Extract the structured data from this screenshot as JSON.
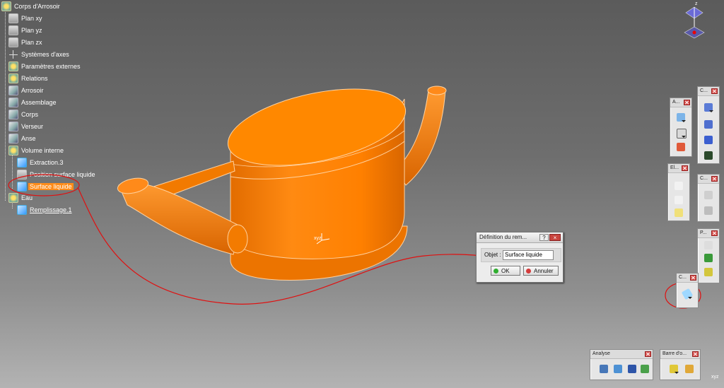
{
  "tree": {
    "root": "Corps d'Arrosoir",
    "items": [
      {
        "label": "Plan xy",
        "icon": "plane-icon"
      },
      {
        "label": "Plan yz",
        "icon": "plane-icon"
      },
      {
        "label": "Plan zx",
        "icon": "plane-icon"
      },
      {
        "label": "Systèmes d'axes",
        "icon": "axis-system-icon"
      },
      {
        "label": "Paramètres externes",
        "icon": "parameters-icon"
      },
      {
        "label": "Relations",
        "icon": "relations-icon"
      },
      {
        "label": "Arrosoir",
        "icon": "body-icon"
      },
      {
        "label": "Assemblage",
        "icon": "body-icon"
      },
      {
        "label": "Corps",
        "icon": "body-icon"
      },
      {
        "label": "Verseur",
        "icon": "body-icon"
      },
      {
        "label": "Anse",
        "icon": "body-icon"
      },
      {
        "label": "Volume interne",
        "icon": "geometrical-set-icon"
      },
      {
        "label": "Extraction.3",
        "icon": "extract-icon"
      },
      {
        "label": "Position surface liquide",
        "icon": "plane-icon"
      },
      {
        "label": "Surface liquide",
        "icon": "surface-icon"
      },
      {
        "label": "Eau",
        "icon": "body-icon"
      },
      {
        "label": "Remplissage.1",
        "icon": "fill-icon"
      }
    ]
  },
  "toolbars": {
    "a": {
      "title": "A..."
    },
    "c1": {
      "title": "C..."
    },
    "el": {
      "title": "El..."
    },
    "c2": {
      "title": "C..."
    },
    "p": {
      "title": "P..."
    },
    "c3": {
      "title": "C..."
    },
    "analyse": {
      "title": "Analyse"
    },
    "barre": {
      "title": "Barre d'o..."
    }
  },
  "dialog": {
    "title": "Définition du rem...",
    "help": "?",
    "close": "×",
    "field_label": "Objet :",
    "field_value": "Surface liquide",
    "ok": "OK",
    "cancel": "Annuler"
  },
  "compass": {
    "z_label": "z"
  },
  "axis_labels": {
    "model": "xyz",
    "corner": "xyz"
  },
  "colors": {
    "model": "#ff7f00",
    "selection": "#ff8c1a",
    "annotation": "#e01010",
    "background_top": "#5b5b5b",
    "background_bottom": "#b3b3b3"
  }
}
